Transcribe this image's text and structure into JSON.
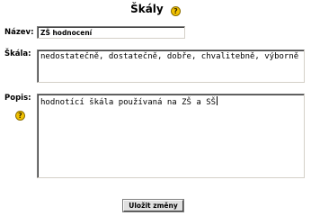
{
  "page": {
    "title": "Škály",
    "help_icon": "help-icon",
    "accent_color": "#f2c200"
  },
  "form": {
    "nazev_label": "Název:",
    "nazev_value": "ZŠ hodnocení",
    "skala_label": "Škála:",
    "skala_value": "nedostatečně, dostatečně, dobře, chvalitebně, výborně",
    "popis_label": "Popis:",
    "popis_value": "hodnotící škála používaná na ZŠ a SŠ",
    "save_label": "Uložit změny"
  }
}
